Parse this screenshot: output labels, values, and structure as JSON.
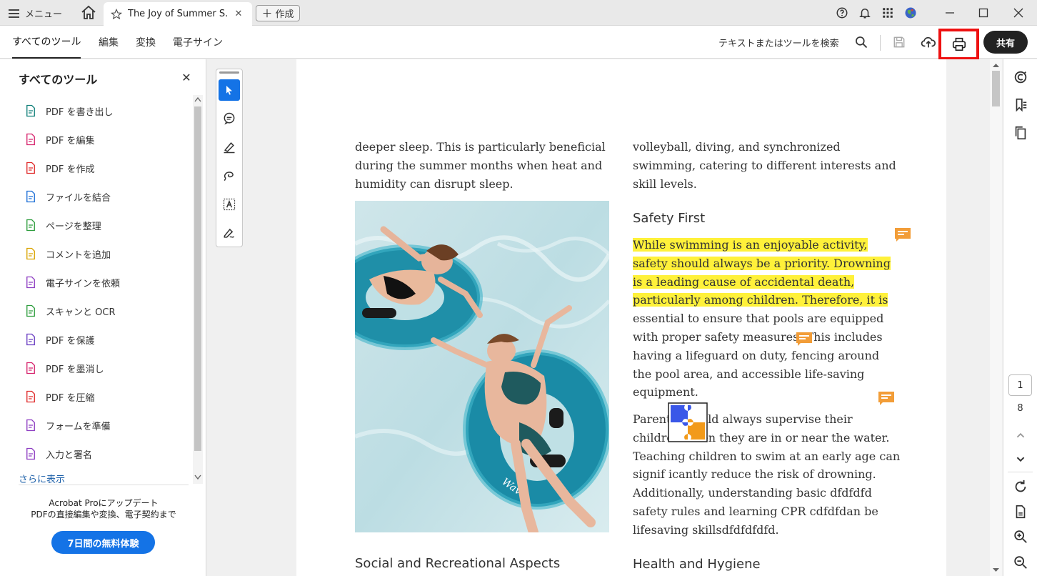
{
  "titlebar": {
    "menu_label": "メニュー",
    "doc_tab_title": "The Joy of Summer S...",
    "create_label": "作成"
  },
  "toolbar": {
    "tabs": [
      "すべてのツール",
      "編集",
      "変換",
      "電子サイン"
    ],
    "search_label": "テキストまたはツールを検索",
    "share_label": "共有"
  },
  "left_panel": {
    "title": "すべてのツール",
    "tools": [
      {
        "label": "PDF を書き出し",
        "icon": "export-pdf-icon",
        "color": "#12807a"
      },
      {
        "label": "PDF を編集",
        "icon": "edit-pdf-icon",
        "color": "#d6246e"
      },
      {
        "label": "PDF を作成",
        "icon": "create-pdf-icon",
        "color": "#e02b2b"
      },
      {
        "label": "ファイルを結合",
        "icon": "combine-files-icon",
        "color": "#1d6fd6"
      },
      {
        "label": "ページを整理",
        "icon": "organize-pages-icon",
        "color": "#2e9d3e"
      },
      {
        "label": "コメントを追加",
        "icon": "add-comment-icon",
        "color": "#d9a300"
      },
      {
        "label": "電子サインを依頼",
        "icon": "request-esign-icon",
        "color": "#8e3ec2"
      },
      {
        "label": "スキャンと OCR",
        "icon": "scan-ocr-icon",
        "color": "#2e9d3e"
      },
      {
        "label": "PDF を保護",
        "icon": "protect-pdf-icon",
        "color": "#6a3ec2"
      },
      {
        "label": "PDF を墨消し",
        "icon": "redact-pdf-icon",
        "color": "#d6246e"
      },
      {
        "label": "PDF を圧縮",
        "icon": "compress-pdf-icon",
        "color": "#e02b2b"
      },
      {
        "label": "フォームを準備",
        "icon": "prepare-form-icon",
        "color": "#8e3ec2"
      },
      {
        "label": "入力と署名",
        "icon": "fill-sign-icon",
        "color": "#8e3ec2"
      }
    ],
    "show_more": "さらに表示",
    "upsell_line1": "Acrobat Proにアップデート",
    "upsell_line2": "PDFの直接編集や変換、電子契約まで",
    "trial_button": "7日間の無料体験"
  },
  "document": {
    "left_col_lines": [
      "deeper sleep. This is particularly beneficial",
      "during the summer months when heat and",
      "humidity can disrupt sleep."
    ],
    "right_top_lines": [
      "volleyball, diving, and synchronized",
      "swimming, catering to different interests and",
      "skill levels."
    ],
    "heading_safety": "Safety First",
    "safety_highlighted": [
      "While swimming is an enjoyable activity,",
      "safety should always be a priority. Drowning",
      "is a leading cause of accidental death,",
      "particularly among children. Therefore, it is"
    ],
    "safety_lines": [
      "essential to ensure that pools are equipped",
      "with proper safety measures. This includes",
      "having a lifeguard on duty, fencing around",
      "the pool area, and accessible life-saving",
      "equipment."
    ],
    "parents_lines": [
      "Parents should always supervise their",
      "children when they are in or near the water.",
      "Teaching children to swim at an early age can",
      "signif icantly reduce the risk of drowning.",
      "Additionally, understanding basic dfdfdfd",
      "safety rules and learning CPR cdfdfdan be",
      "lifesaving skillsdfdfdfdfd."
    ],
    "heading_social": "Social and Recreational Aspects",
    "heading_health": "Health and Hygiene",
    "photo_text": "Wave"
  },
  "page_nav": {
    "current": "1",
    "total": "8"
  },
  "colors": {
    "accent": "#1473e6",
    "highlight": "#fff13a",
    "comment": "#f29d38",
    "print_outline": "#ee1111"
  }
}
